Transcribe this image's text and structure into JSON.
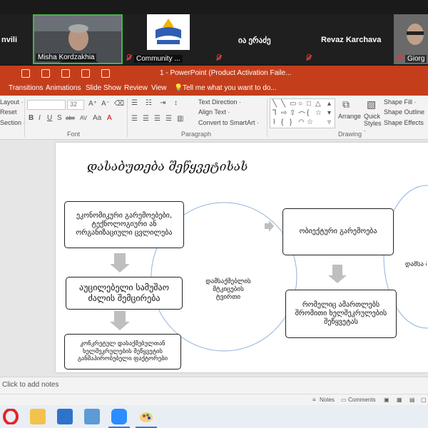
{
  "zoom": {
    "participants": [
      {
        "name": "nvili"
      },
      {
        "name": "Misha Kordzakhia"
      },
      {
        "name": "Community ..."
      },
      {
        "name": "ია ერაძე"
      },
      {
        "name": "Revaz Karchava"
      },
      {
        "name": "Giorg"
      }
    ]
  },
  "app": {
    "title": "1 - PowerPoint (Product Activation Faile..."
  },
  "ribbon": {
    "tabs": [
      "Transitions",
      "Animations",
      "Slide Show",
      "Review",
      "View"
    ],
    "tell_me": "Tell me what you want to do...",
    "slides_group": {
      "layout": "Layout ·",
      "reset": "Reset",
      "section": "Section ·"
    },
    "font": {
      "size": "32",
      "group": "Font",
      "buttons": [
        "B",
        "I",
        "U",
        "S",
        "abc",
        "AV",
        "Aa",
        "A"
      ]
    },
    "paragraph": {
      "text_direction": "Text Direction ·",
      "align_text": "Align Text ·",
      "smartart": "Convert to SmartArt ·",
      "group": "Paragraph"
    },
    "drawing": {
      "arrange": "Arrange",
      "quick_styles": "Quick Styles ·",
      "shape_fill": "Shape Fill ·",
      "shape_outline": "Shape Outline",
      "shape_effects": "Shape Effects",
      "group": "Drawing"
    }
  },
  "slide": {
    "title": "დასაბუთება შეწყვეტისას",
    "left_boxes": [
      "ეკონომიკური გარემოებები, ტექნოლოგიური ან ორგანიზაციული ცვლილება",
      "აუცილებელი სამუშაო ძალის შემცირება",
      "კონკრეტულ დასაქმებულთან ხელშეკრულების შეწყვეტის განმაპირობებელი ფაქტორები"
    ],
    "center_text": "დამსაქმებლის მტკიცების ტვირთი",
    "right_boxes": [
      "ობიექტური გარემოება",
      "რომელიც ამართლებს შრომითი ხელშეკრულების შეწყვეტას"
    ],
    "right_partial_text": "დამსა მტ ტ"
  },
  "notes": {
    "placeholder": "Click to add notes"
  },
  "statusbar": {
    "notes": "Notes",
    "comments": "Comments"
  },
  "colors": {
    "ppt_accent": "#c43e1c",
    "zoom_bg": "#1a1a1a"
  }
}
